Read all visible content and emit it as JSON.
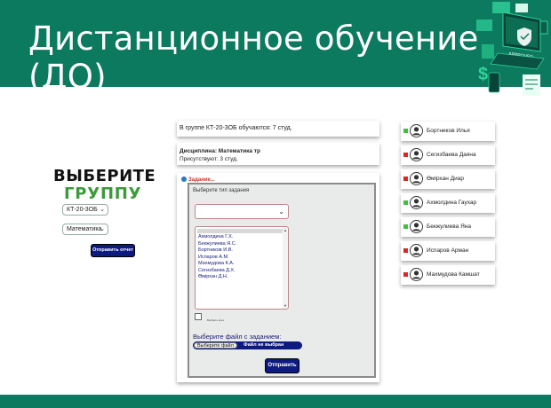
{
  "header": {
    "title": "Дистанционное обучение (ДО)",
    "badge_text": "APPROVED"
  },
  "colors": {
    "brand": "#0c7a5e",
    "accent_green": "#3c9a3c",
    "button_navy": "#0d1a80",
    "present": "#3fbf3f",
    "absent": "#d42a2a"
  },
  "left_panel": {
    "choose_line1": "ВЫБЕРИТЕ",
    "choose_line2": "ГРУППУ",
    "group_select_value": "КТ-20-3ОБ",
    "discipline_select_value": "Математика",
    "send_report_label": "Отправить отчет"
  },
  "info": {
    "group_text": "В группе КТ-20-3ОБ обучаются: 7 студ.",
    "discipline_label": "Дисциплина: Математика тр",
    "present_text": "Присутствуют: 3 студ."
  },
  "task": {
    "header": "Задание...",
    "type_label": "Выберите тип задания",
    "type_select_value": "",
    "students": [
      "Ахмолдина Г.Х.",
      "Бекжулиева Я.С.",
      "Бортников И.В.",
      "Испаров А.М.",
      "Махмудова К.А.",
      "Сегизбаева Д.Х.",
      "Өмірхан Д.Н."
    ],
    "checkbox_label": "Выбрать всех",
    "file_label": "Выберите файл с заданием:",
    "file_button": "Выберите файл",
    "file_status": "Файл не выбран",
    "submit_label": "Отправить"
  },
  "roster": [
    {
      "name": "Бортников Илья",
      "status": "present"
    },
    {
      "name": "Сегизбаева Даяна",
      "status": "absent"
    },
    {
      "name": "Өмірхан Диар",
      "status": "absent"
    },
    {
      "name": "Ахмолдина Гаухар",
      "status": "present"
    },
    {
      "name": "Бекжулиева Яна",
      "status": "present"
    },
    {
      "name": "Испаров Арман",
      "status": "absent"
    },
    {
      "name": "Махмудова Камшат",
      "status": "absent"
    }
  ]
}
